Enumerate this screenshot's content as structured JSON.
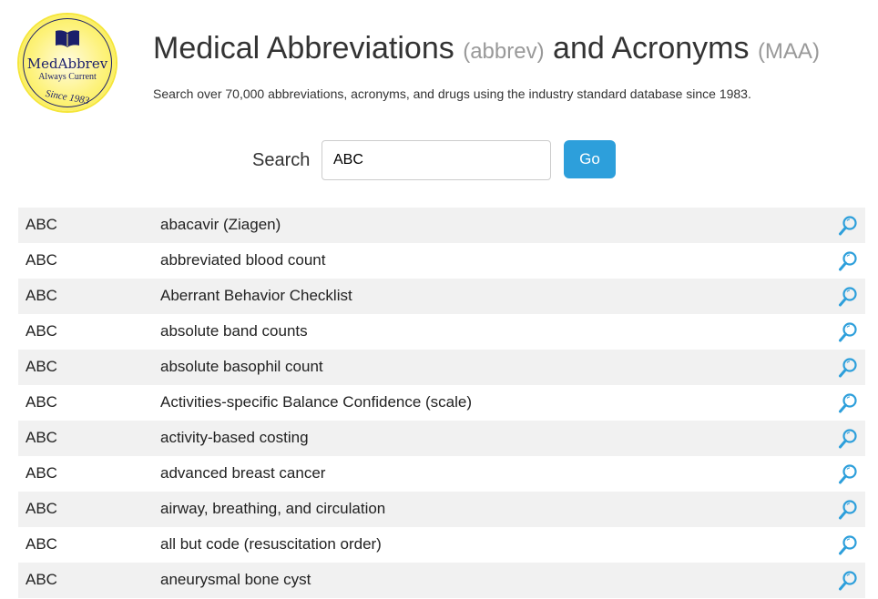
{
  "logo": {
    "name": "MedAbbrev",
    "tagline": "Always Current",
    "since": "Since 1983"
  },
  "header": {
    "title_a": "Medical Abbreviations",
    "title_b": "(abbrev)",
    "title_c": "and Acronyms",
    "title_d": "(MAA)",
    "subtitle": "Search over 70,000 abbreviations, acronyms, and drugs using the industry standard database since 1983."
  },
  "search": {
    "label": "Search",
    "value": "ABC",
    "button": "Go"
  },
  "colors": {
    "accent": "#2d9fdb",
    "icon": "#2d9fdb"
  },
  "results": [
    {
      "abbr": "ABC",
      "def": "abacavir (Ziagen)"
    },
    {
      "abbr": "ABC",
      "def": "abbreviated blood count"
    },
    {
      "abbr": "ABC",
      "def": "Aberrant Behavior Checklist"
    },
    {
      "abbr": "ABC",
      "def": "absolute band counts"
    },
    {
      "abbr": "ABC",
      "def": "absolute basophil count"
    },
    {
      "abbr": "ABC",
      "def": "Activities-specific Balance Confidence (scale)"
    },
    {
      "abbr": "ABC",
      "def": "activity-based costing"
    },
    {
      "abbr": "ABC",
      "def": "advanced breast cancer"
    },
    {
      "abbr": "ABC",
      "def": "airway, breathing, and circulation"
    },
    {
      "abbr": "ABC",
      "def": "all but code (resuscitation order)"
    },
    {
      "abbr": "ABC",
      "def": "aneurysmal bone cyst"
    }
  ]
}
